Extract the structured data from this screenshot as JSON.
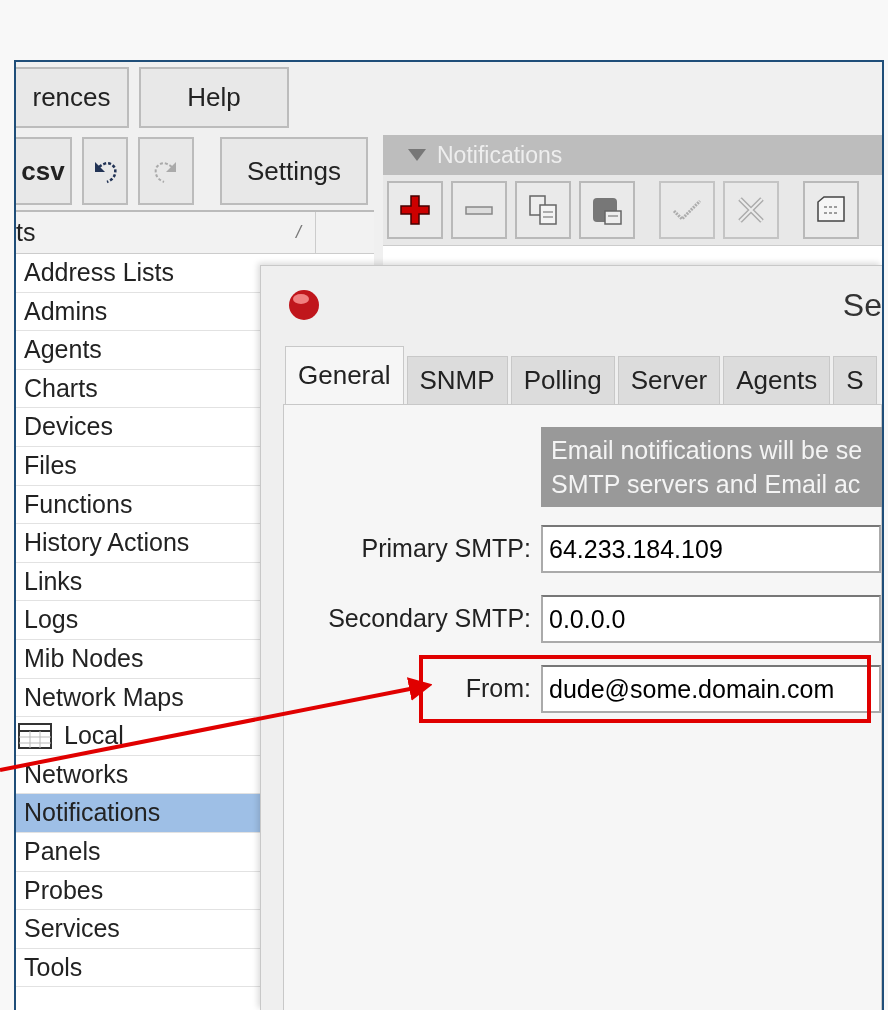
{
  "menu": [
    {
      "label": "rences"
    },
    {
      "label": "Help"
    }
  ],
  "toolbar": [
    {
      "kind": "text",
      "label": "csv",
      "disabled": false
    },
    {
      "kind": "undo",
      "disabled": false
    },
    {
      "kind": "redo",
      "disabled": true
    },
    {
      "kind": "text",
      "label": "Settings",
      "disabled": false
    }
  ],
  "list": {
    "header": "ts",
    "sort_mark": "/",
    "items": [
      {
        "kind": "item",
        "label": "Address Lists",
        "selected": false
      },
      {
        "kind": "item",
        "label": "Admins",
        "selected": false
      },
      {
        "kind": "item",
        "label": "Agents",
        "selected": false
      },
      {
        "kind": "item",
        "label": "Charts",
        "selected": false
      },
      {
        "kind": "item",
        "label": "Devices",
        "selected": false
      },
      {
        "kind": "item",
        "label": "Files",
        "selected": false
      },
      {
        "kind": "item",
        "label": "Functions",
        "selected": false
      },
      {
        "kind": "item",
        "label": "History Actions",
        "selected": false
      },
      {
        "kind": "item",
        "label": "Links",
        "selected": false
      },
      {
        "kind": "item",
        "label": "Logs",
        "selected": false
      },
      {
        "kind": "item",
        "label": "Mib Nodes",
        "selected": false
      },
      {
        "kind": "item",
        "label": "Network Maps",
        "selected": false
      },
      {
        "kind": "group",
        "label": "Local",
        "selected": false
      },
      {
        "kind": "item",
        "label": "Networks",
        "selected": false
      },
      {
        "kind": "item",
        "label": "Notifications",
        "selected": true
      },
      {
        "kind": "item",
        "label": "Panels",
        "selected": false
      },
      {
        "kind": "item",
        "label": "Probes",
        "selected": false
      },
      {
        "kind": "item",
        "label": "Services",
        "selected": false
      },
      {
        "kind": "item",
        "label": "Tools",
        "selected": false
      }
    ]
  },
  "notifications_panel": {
    "title": "Notifications",
    "tools": [
      {
        "kind": "add",
        "disabled": false
      },
      {
        "kind": "remove",
        "disabled": false
      },
      {
        "kind": "copy",
        "disabled": false
      },
      {
        "kind": "paste",
        "disabled": false
      },
      {
        "kind": "enable",
        "disabled": true
      },
      {
        "kind": "disable",
        "disabled": true
      },
      {
        "kind": "comment",
        "disabled": false
      }
    ]
  },
  "dialog": {
    "title": "Se",
    "tabs": [
      {
        "label": "General",
        "selected": true
      },
      {
        "label": "SNMP",
        "selected": false
      },
      {
        "label": "Polling",
        "selected": false
      },
      {
        "label": "Server",
        "selected": false
      },
      {
        "label": "Agents",
        "selected": false
      },
      {
        "label": "S",
        "selected": false
      }
    ],
    "info": [
      "Email notifications will be se",
      "SMTP servers and Email ac"
    ],
    "fields": [
      {
        "label": "Primary SMTP:",
        "value": "64.233.184.109",
        "highlighted": false
      },
      {
        "label": "Secondary SMTP:",
        "value": "0.0.0.0",
        "highlighted": false
      },
      {
        "label": "From:",
        "value": "dude@some.domain.com",
        "highlighted": true
      }
    ]
  }
}
